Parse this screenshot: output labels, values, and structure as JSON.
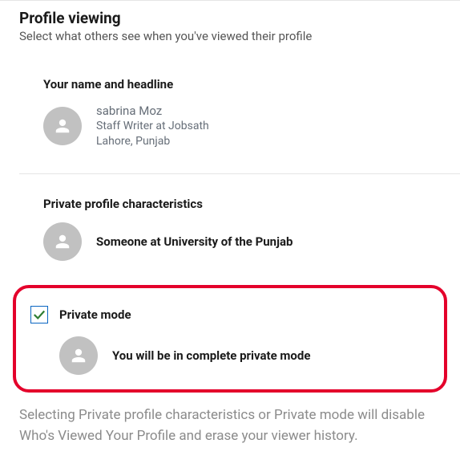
{
  "header": {
    "title": "Profile viewing",
    "subtitle": "Select what others see when you've viewed their profile"
  },
  "options": {
    "full": {
      "title": "Your name and headline",
      "name": "sabrina Moz",
      "headline": "Staff Writer at Jobsath",
      "location": "Lahore, Punjab"
    },
    "semi": {
      "title": "Private profile characteristics",
      "description": "Someone at University of the Punjab"
    },
    "private": {
      "title": "Private mode",
      "description": "You will be in complete private mode",
      "checked": true
    }
  },
  "footer": "Selecting Private profile characteristics or Private mode will disable Who's Viewed Your Profile and erase your viewer history."
}
